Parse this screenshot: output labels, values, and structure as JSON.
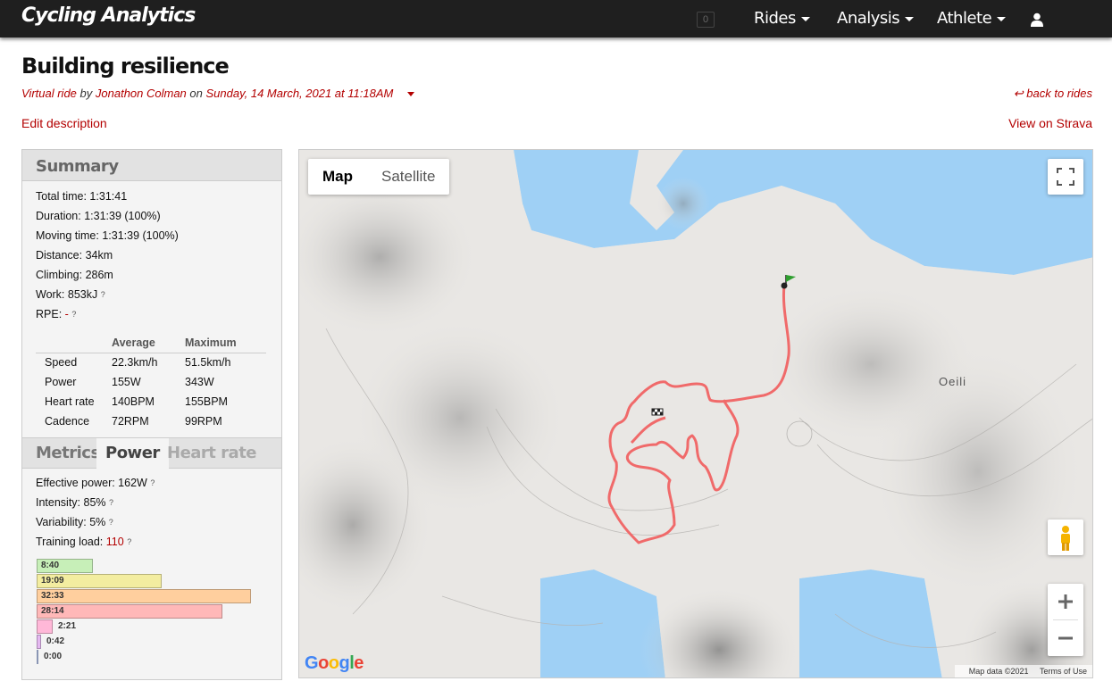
{
  "nav": {
    "brand": "Cycling Analytics",
    "badge_count": "0",
    "items": [
      "Rides",
      "Analysis",
      "Athlete"
    ]
  },
  "header": {
    "title": "Building resilience",
    "ride_type": "Virtual ride",
    "by": "by",
    "athlete": "Jonathon Colman",
    "on": "on",
    "date": "Sunday, 14 March, 2021 at 11:18AM",
    "back_link": "↩ back to rides",
    "edit_link": "Edit description",
    "strava_link": "View on Strava"
  },
  "summary": {
    "heading": "Summary",
    "total_time": "Total time: 1:31:41",
    "duration": "Duration: 1:31:39 (100%)",
    "moving_time": "Moving time: 1:31:39 (100%)",
    "distance": "Distance: 34km",
    "climbing": "Climbing: 286m",
    "work": "Work: 853kJ",
    "rpe_label": "RPE:",
    "rpe_value": "-",
    "help": "?",
    "table": {
      "headers": [
        "",
        "Average",
        "Maximum"
      ],
      "rows": [
        [
          "Speed",
          "22.3km/h",
          "51.5km/h"
        ],
        [
          "Power",
          "155W",
          "343W"
        ],
        [
          "Heart rate",
          "140BPM",
          "155BPM"
        ],
        [
          "Cadence",
          "72RPM",
          "99RPM"
        ]
      ]
    }
  },
  "tabs": [
    "Metrics",
    "Power",
    "Heart rate"
  ],
  "power_metrics": {
    "effective_power": "Effective power: 162W",
    "intensity": "Intensity: 85%",
    "variability": "Variability: 5%",
    "training_load_label": "Training load:",
    "training_load_value": "110"
  },
  "zones": [
    {
      "time": "8:40",
      "fraction": 0.25,
      "color": "#c7efb8"
    },
    {
      "time": "19:09",
      "fraction": 0.56,
      "color": "#f3eda0"
    },
    {
      "time": "32:33",
      "fraction": 0.96,
      "color": "#ffcf9e"
    },
    {
      "time": "28:14",
      "fraction": 0.83,
      "color": "#ffb8b8"
    },
    {
      "time": "2:21",
      "fraction": 0.07,
      "color": "#ffb8d8"
    },
    {
      "time": "0:42",
      "fraction": 0.02,
      "color": "#e4b8f0"
    },
    {
      "time": "0:00",
      "fraction": 0.0,
      "color": "#b8c8f0"
    }
  ],
  "map": {
    "type_map": "Map",
    "type_satellite": "Satellite",
    "place": "Oeili",
    "google": [
      "G",
      "o",
      "o",
      "g",
      "l",
      "e"
    ],
    "google_colors": [
      "#4285f4",
      "#ea4335",
      "#fbbc05",
      "#4285f4",
      "#34a853",
      "#ea4335"
    ],
    "attribution": "Map data ©2021",
    "terms": "Terms of Use",
    "route_color": "#f06a6a",
    "water_color": "#9fd0f5"
  }
}
